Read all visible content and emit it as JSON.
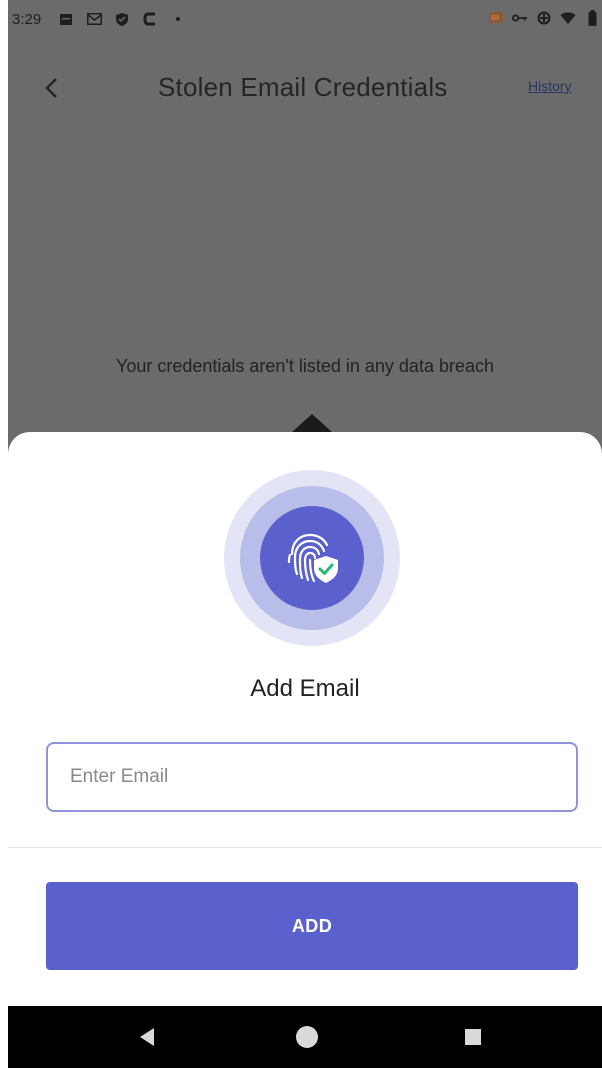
{
  "status_bar": {
    "time": "3:29",
    "left_icons": [
      "calendar-icon",
      "mail-icon",
      "shield-icon",
      "cc-icon",
      "dot-icon"
    ],
    "right_icons": [
      "cast-icon",
      "vpn-key-icon",
      "data-saver-icon",
      "wifi-icon",
      "battery-icon"
    ]
  },
  "app_bar": {
    "title": "Stolen Email Credentials",
    "history_label": "History"
  },
  "main": {
    "empty_message": "Your credentials aren't listed in any data breach"
  },
  "sheet": {
    "icon": "fingerprint-shield-icon",
    "title": "Add Email",
    "email_input": {
      "placeholder": "Enter Email",
      "value": ""
    },
    "add_button_label": "ADD"
  },
  "nav_bar": {
    "buttons": [
      "back-triangle-icon",
      "home-circle-icon",
      "recents-square-icon"
    ]
  },
  "colors": {
    "accent": "#5A61CC",
    "ring_light": "#E3E5F7",
    "ring_mid": "#B8BDE9",
    "scrim": "#6B6B6B",
    "check_green": "#2BB673"
  }
}
